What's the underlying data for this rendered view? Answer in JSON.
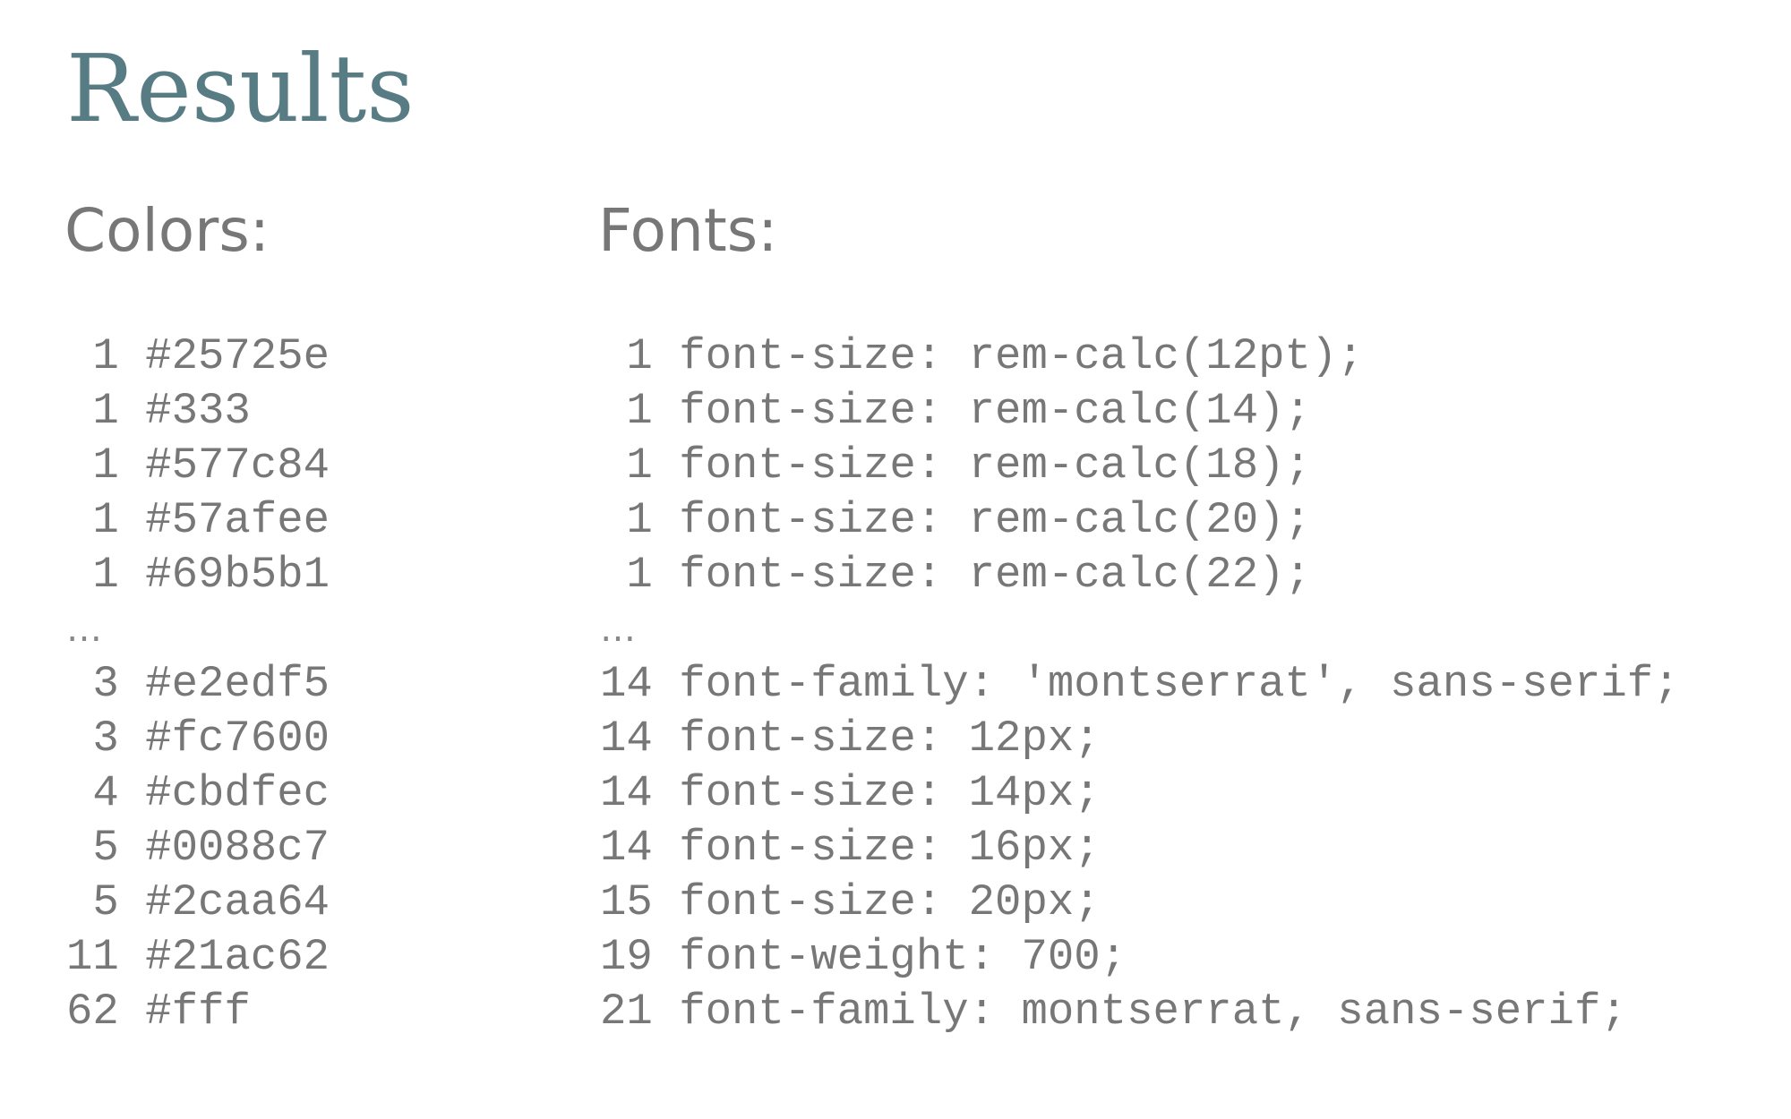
{
  "title": "Results",
  "colors": {
    "heading": "Colors:",
    "top": [
      {
        "count": "1",
        "value": "#25725e"
      },
      {
        "count": "1",
        "value": "#333"
      },
      {
        "count": "1",
        "value": "#577c84"
      },
      {
        "count": "1",
        "value": "#57afee"
      },
      {
        "count": "1",
        "value": "#69b5b1"
      }
    ],
    "ellipsis": "…",
    "bottom": [
      {
        "count": "3",
        "value": "#e2edf5"
      },
      {
        "count": "3",
        "value": "#fc7600"
      },
      {
        "count": "4",
        "value": "#cbdfec"
      },
      {
        "count": "5",
        "value": "#0088c7"
      },
      {
        "count": "5",
        "value": "#2caa64"
      },
      {
        "count": "11",
        "value": "#21ac62"
      },
      {
        "count": "62",
        "value": "#fff"
      }
    ]
  },
  "fonts": {
    "heading": "Fonts:",
    "top": [
      {
        "count": "1",
        "value": "font-size: rem-calc(12pt);"
      },
      {
        "count": "1",
        "value": "font-size: rem-calc(14);"
      },
      {
        "count": "1",
        "value": "font-size: rem-calc(18);"
      },
      {
        "count": "1",
        "value": "font-size: rem-calc(20);"
      },
      {
        "count": "1",
        "value": "font-size: rem-calc(22);"
      }
    ],
    "ellipsis": "…",
    "bottom": [
      {
        "count": "14",
        "value": "font-family: 'montserrat', sans-serif;"
      },
      {
        "count": "14",
        "value": "font-size: 12px;"
      },
      {
        "count": "14",
        "value": "font-size: 14px;"
      },
      {
        "count": "14",
        "value": "font-size: 16px;"
      },
      {
        "count": "15",
        "value": "font-size: 20px;"
      },
      {
        "count": "19",
        "value": "font-weight: 700;"
      },
      {
        "count": "21",
        "value": "font-family: montserrat, sans-serif;"
      }
    ]
  },
  "colors_palette": {
    "title": "#577c84",
    "text": "#777777",
    "background": "#ffffff"
  }
}
